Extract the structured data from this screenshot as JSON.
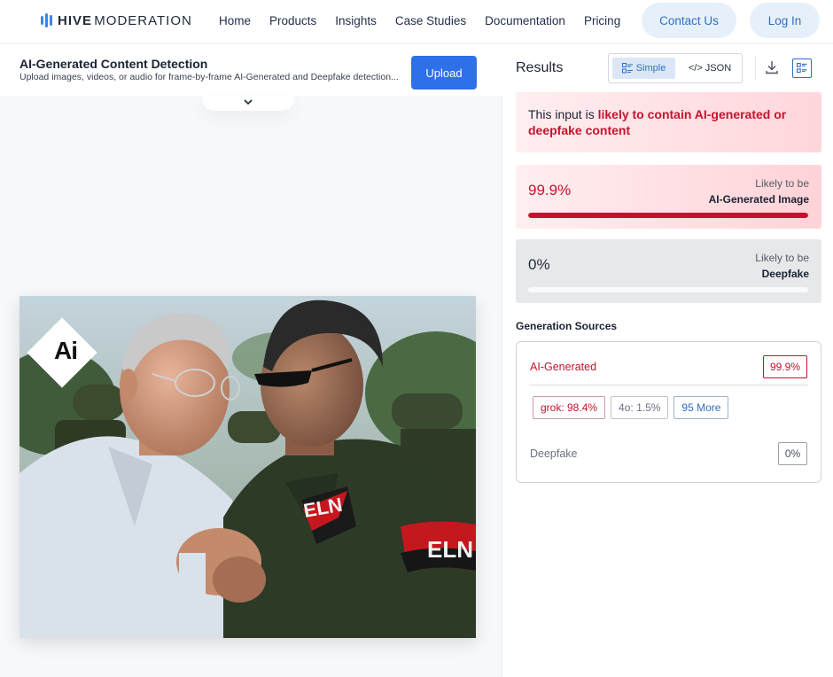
{
  "nav": {
    "logo_bold": "HIVE",
    "logo_rest": "MODERATION",
    "links": [
      "Home",
      "Products",
      "Insights",
      "Case Studies",
      "Documentation",
      "Pricing"
    ],
    "contact_label": "Contact Us",
    "login_label": "Log In"
  },
  "upload": {
    "title": "AI-Generated Content Detection",
    "description": "Upload images, videos, or audio for frame-by-frame AI-Generated and Deepfake detection...",
    "button_label": "Upload"
  },
  "image": {
    "badge_text": "Ai",
    "armband_text": "ELN"
  },
  "results": {
    "label": "Results",
    "view_simple": "Simple",
    "view_json": "</> JSON",
    "verdict_prefix": "This input is ",
    "verdict_highlight": "likely to contain AI-generated or deepfake content",
    "ai_score": {
      "value": "99.9%",
      "fill_fraction": 0.999,
      "sub_line1": "Likely to be",
      "sub_line2": "AI-Generated Image"
    },
    "deepfake_score": {
      "value": "0%",
      "fill_fraction": 0,
      "sub_line1": "Likely to be",
      "sub_line2": "Deepfake"
    }
  },
  "sources": {
    "title": "Generation Sources",
    "ai_label": "AI-Generated",
    "ai_value": "99.9%",
    "chips": [
      "grok: 98.4%",
      "4o: 1.5%",
      "95 More"
    ],
    "deepfake_label": "Deepfake",
    "deepfake_value": "0%"
  },
  "colors": {
    "accent": "#2f6fe8",
    "danger": "#c3142d"
  }
}
